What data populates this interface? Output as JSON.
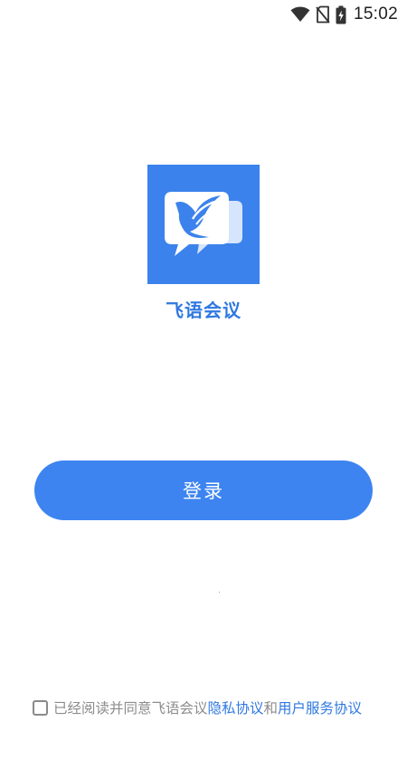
{
  "status_bar": {
    "time": "15:02",
    "icons": [
      "wifi-icon",
      "no-sim-icon",
      "battery-charging-icon"
    ]
  },
  "app": {
    "name": "飞语会议",
    "logo_icon": "bird-chat-bubble-logo",
    "brand_color": "#3b82ec"
  },
  "login": {
    "button_label": "登录",
    "button_color": "#3d84f1"
  },
  "agreement": {
    "checked": false,
    "prefix": "已经阅读并同意飞语会议",
    "privacy_link": "隐私协议",
    "joiner": "和",
    "terms_link": "用户服务协议",
    "link_color": "#2f78e0"
  }
}
